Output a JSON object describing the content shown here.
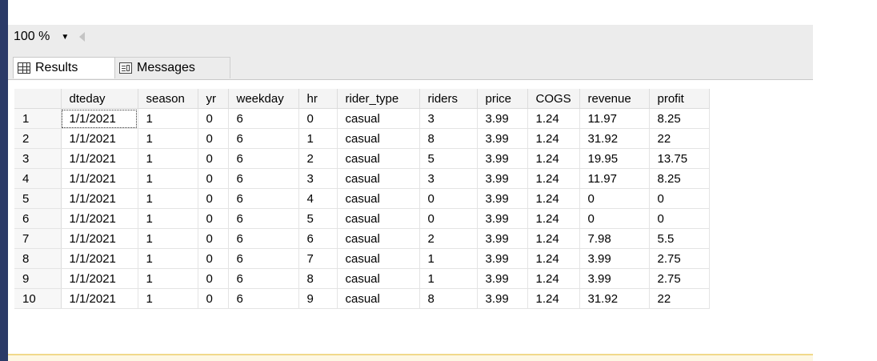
{
  "zoom": {
    "value": "100 %"
  },
  "tabs": [
    {
      "label": "Results",
      "icon": "grid-icon"
    },
    {
      "label": "Messages",
      "icon": "messages-icon"
    }
  ],
  "table": {
    "columns": [
      "",
      "dteday",
      "season",
      "yr",
      "weekday",
      "hr",
      "rider_type",
      "riders",
      "price",
      "COGS",
      "revenue",
      "profit"
    ],
    "rows": [
      [
        "1",
        "1/1/2021",
        "1",
        "0",
        "6",
        "0",
        "casual",
        "3",
        "3.99",
        "1.24",
        "11.97",
        "8.25"
      ],
      [
        "2",
        "1/1/2021",
        "1",
        "0",
        "6",
        "1",
        "casual",
        "8",
        "3.99",
        "1.24",
        "31.92",
        "22"
      ],
      [
        "3",
        "1/1/2021",
        "1",
        "0",
        "6",
        "2",
        "casual",
        "5",
        "3.99",
        "1.24",
        "19.95",
        "13.75"
      ],
      [
        "4",
        "1/1/2021",
        "1",
        "0",
        "6",
        "3",
        "casual",
        "3",
        "3.99",
        "1.24",
        "11.97",
        "8.25"
      ],
      [
        "5",
        "1/1/2021",
        "1",
        "0",
        "6",
        "4",
        "casual",
        "0",
        "3.99",
        "1.24",
        "0",
        "0"
      ],
      [
        "6",
        "1/1/2021",
        "1",
        "0",
        "6",
        "5",
        "casual",
        "0",
        "3.99",
        "1.24",
        "0",
        "0"
      ],
      [
        "7",
        "1/1/2021",
        "1",
        "0",
        "6",
        "6",
        "casual",
        "2",
        "3.99",
        "1.24",
        "7.98",
        "5.5"
      ],
      [
        "8",
        "1/1/2021",
        "1",
        "0",
        "6",
        "7",
        "casual",
        "1",
        "3.99",
        "1.24",
        "3.99",
        "2.75"
      ],
      [
        "9",
        "1/1/2021",
        "1",
        "0",
        "6",
        "8",
        "casual",
        "1",
        "3.99",
        "1.24",
        "3.99",
        "2.75"
      ],
      [
        "10",
        "1/1/2021",
        "1",
        "0",
        "6",
        "9",
        "casual",
        "8",
        "3.99",
        "1.24",
        "31.92",
        "22"
      ]
    ]
  },
  "colors": {
    "sidebar": "#2b3a67",
    "toolbar": "#ececec",
    "status_line": "#f1d98a"
  }
}
